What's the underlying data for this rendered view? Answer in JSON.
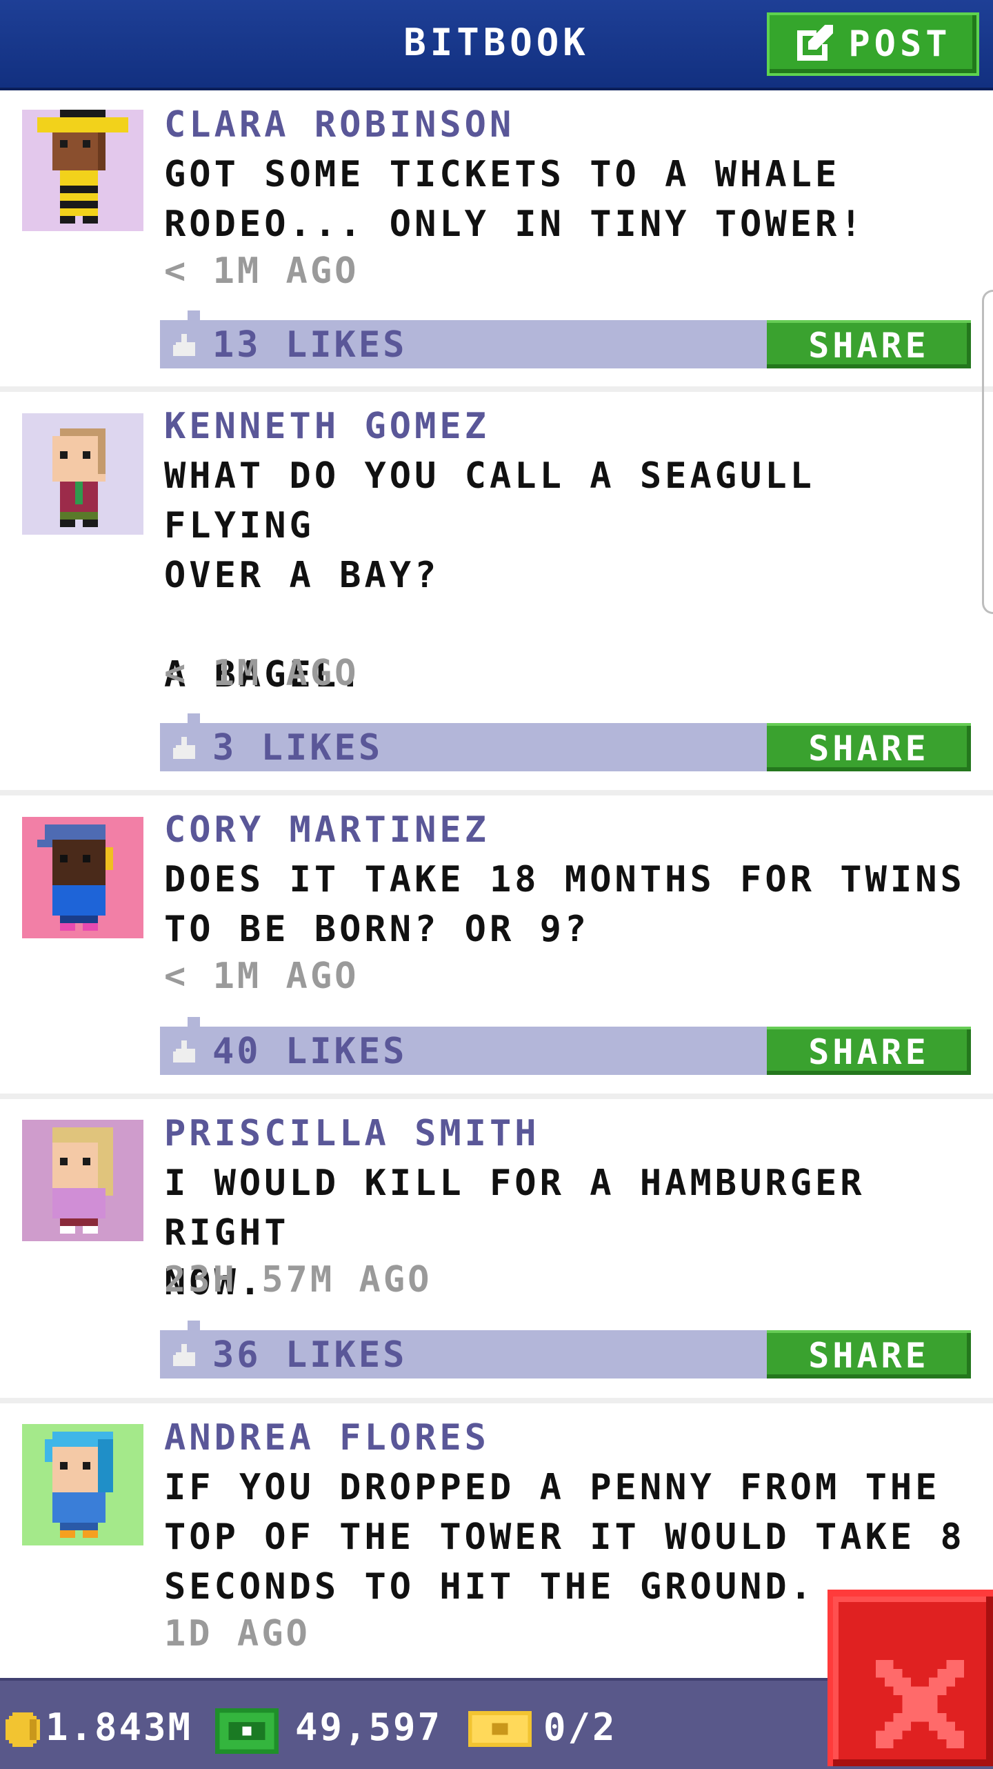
{
  "header": {
    "title": "BITBOOK",
    "post_label": "POST"
  },
  "colors": {
    "header": "#1e3f96",
    "accent_green": "#35a62c",
    "likes_bar": "#b3b6d9",
    "author_text": "#5a5798",
    "footer": "#59588a",
    "close_red": "#e02121"
  },
  "posts": [
    {
      "author": "CLARA ROBINSON",
      "message": "GOT SOME TICKETS TO A WHALE\nRODEO... ONLY IN TINY TOWER!",
      "time": "< 1M AGO",
      "likes": "13 LIKES",
      "share": "SHARE",
      "avatar_bg": "#e3c8ec"
    },
    {
      "author": "KENNETH GOMEZ",
      "message": "WHAT DO YOU CALL A SEAGULL FLYING\nOVER A BAY?\n\nA BAGEL.",
      "time": "< 1M AGO",
      "likes": "3 LIKES",
      "share": "SHARE",
      "avatar_bg": "#ddd6ef"
    },
    {
      "author": "CORY MARTINEZ",
      "message": "DOES IT TAKE 18 MONTHS FOR TWINS\nTO BE BORN? OR 9?",
      "time": "< 1M AGO",
      "likes": "40 LIKES",
      "share": "SHARE",
      "avatar_bg": "#f27fa6"
    },
    {
      "author": "PRISCILLA SMITH",
      "message": "I WOULD KILL FOR A HAMBURGER RIGHT\nNOW.",
      "time": "23H 57M AGO",
      "likes": "36 LIKES",
      "share": "SHARE",
      "avatar_bg": "#cf9ccc"
    },
    {
      "author": "ANDREA FLORES",
      "message": "IF YOU DROPPED A PENNY FROM THE\nTOP OF THE TOWER IT WOULD TAKE 8\nSECONDS TO HIT THE GROUND.",
      "time": "1D AGO",
      "avatar_bg": "#a4e98a"
    }
  ],
  "footer": {
    "coins": "1.843M",
    "bux": "49,597",
    "tickets": "0/2"
  }
}
